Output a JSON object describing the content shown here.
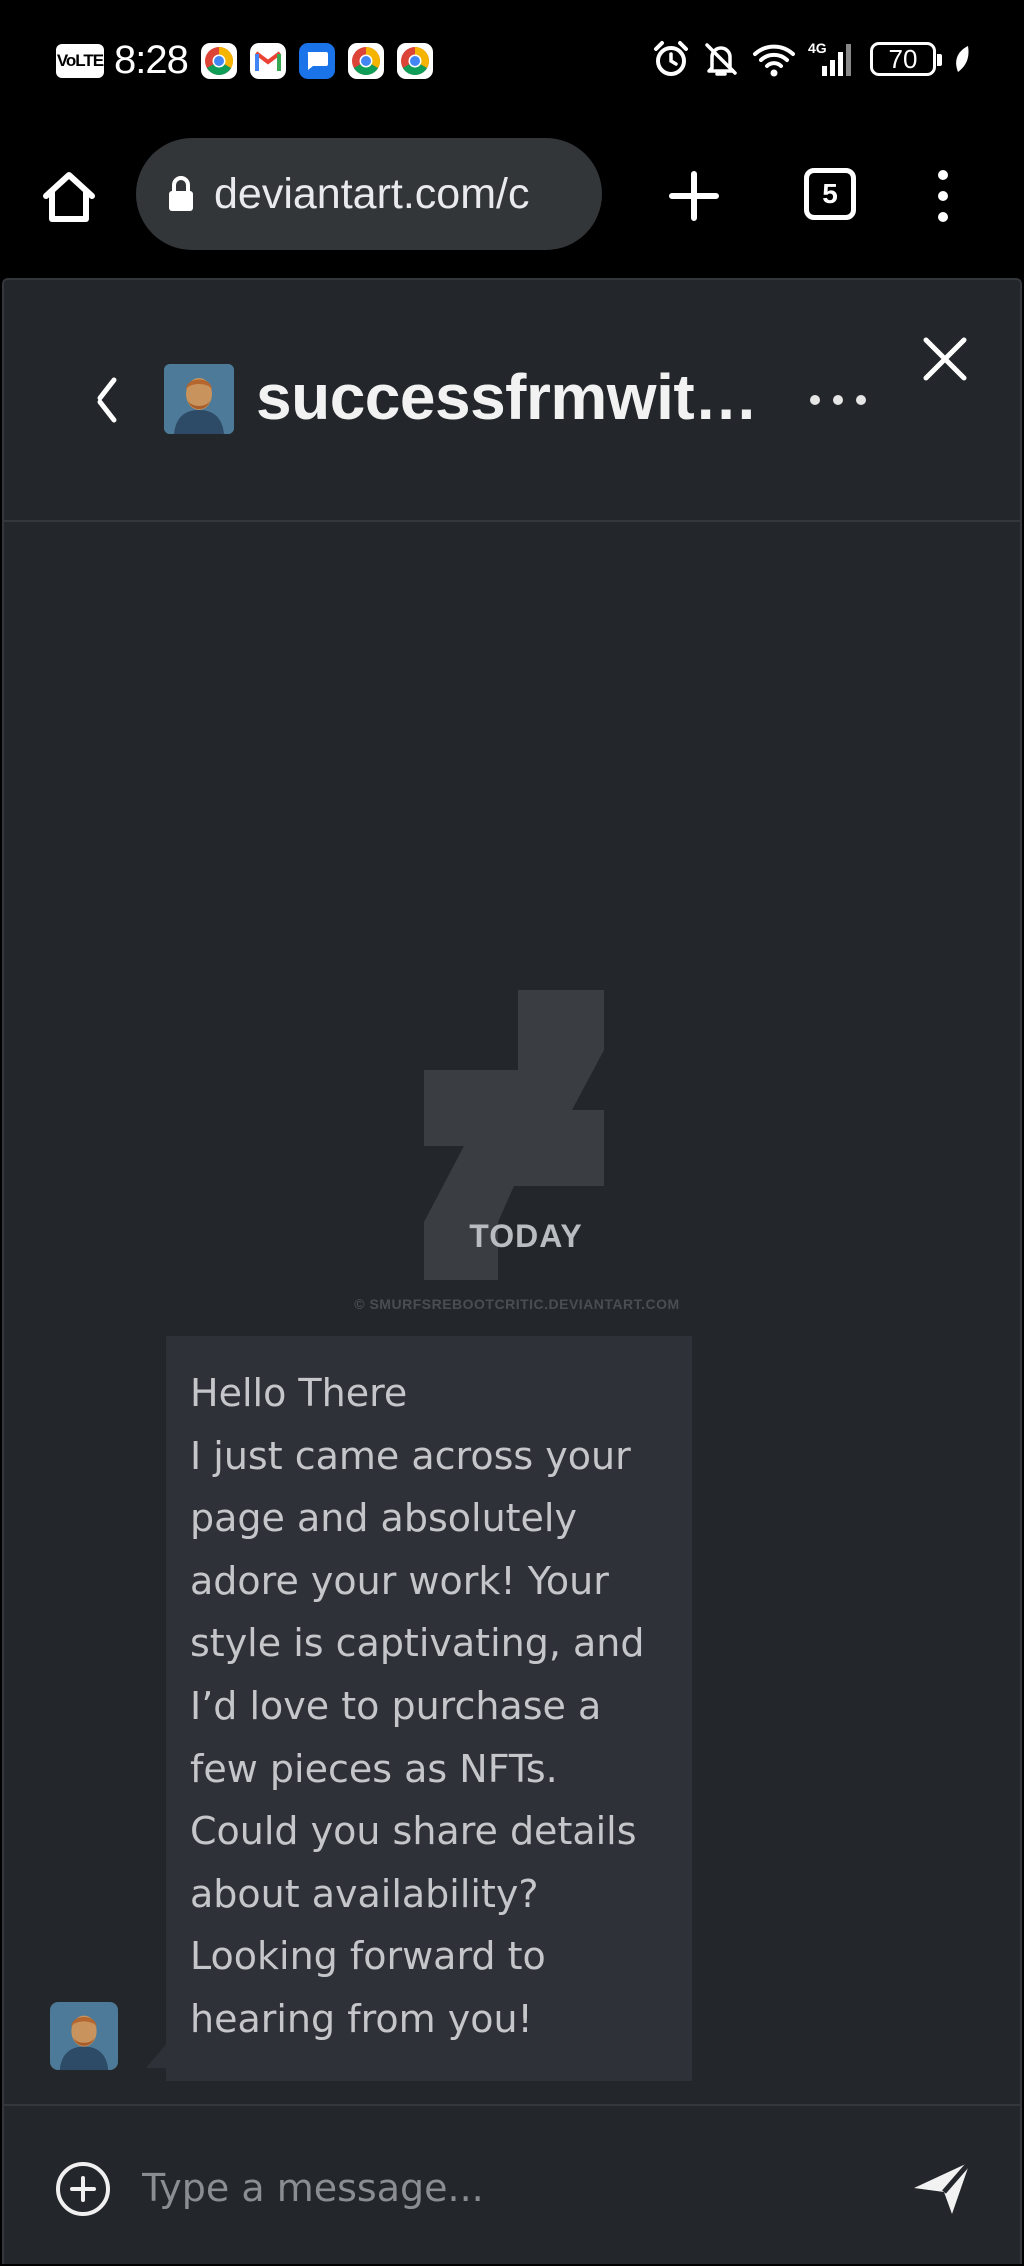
{
  "status_bar": {
    "network_badge": "VoLTE",
    "time": "8:28",
    "notification_icons": [
      "chrome-icon",
      "gmail-icon",
      "messages-icon",
      "chrome-icon",
      "chrome-icon"
    ],
    "system_icons": [
      "alarm-icon",
      "mute-icon",
      "wifi-icon",
      "signal-4g-icon"
    ],
    "network_type": "4G",
    "battery_level": "70"
  },
  "browser": {
    "url": "deviantart.com/c",
    "tab_count": "5"
  },
  "chat": {
    "title": "successfrmwit…",
    "day_label": "TODAY",
    "watermark": "© SMURFSREBOOTCRITIC.DEVIANTART.COM",
    "message": {
      "lines": [
        "Hello There",
        "I just came across your page and absolutely adore your work! Your style is captivating, and I’d love to purchase a few pieces as NFTs. Could you share details about availability?",
        "Looking forward to hearing from you!"
      ]
    },
    "composer": {
      "placeholder": "Type a message..."
    }
  },
  "colors": {
    "panel_bg": "#23262a",
    "bubble_bg": "#2e3138",
    "pill_bg": "#333639",
    "divider": "#34383d"
  }
}
